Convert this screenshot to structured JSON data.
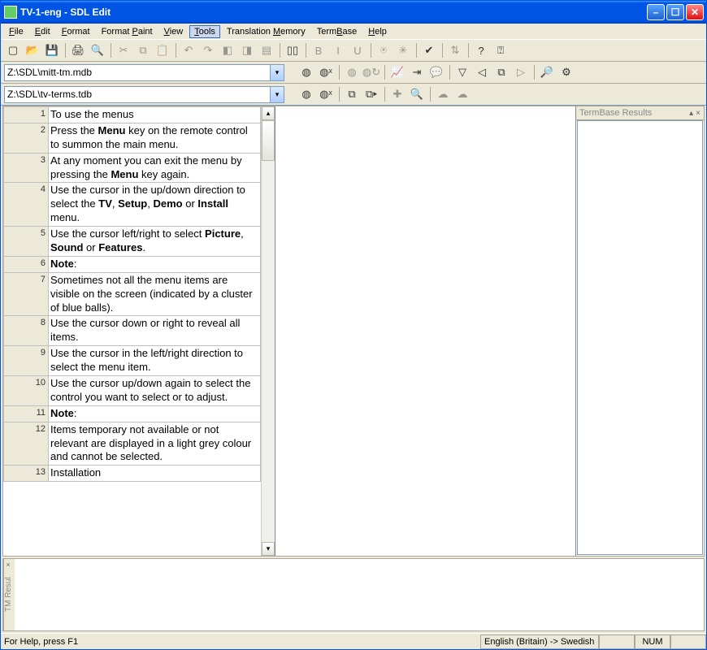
{
  "title": "TV-1-eng - SDL Edit",
  "menus": [
    "File",
    "Edit",
    "Format",
    "Format Paint",
    "View",
    "Tools",
    "Translation Memory",
    "TermBase",
    "Help"
  ],
  "menu_underline_idx": [
    0,
    0,
    0,
    7,
    0,
    0,
    12,
    4,
    0
  ],
  "menu_highlight": 5,
  "tm_path": "Z:\\SDL\\mitt-tm.mdb",
  "tb_path": "Z:\\SDL\\tv-terms.tdb",
  "termbase_panel_title": "TermBase Results",
  "tm_panel_label": "TM Resul",
  "status_help": "For Help, press F1",
  "status_lang": "English (Britain) -> Swedish",
  "status_num": "NUM",
  "segments": [
    {
      "n": 1,
      "html": "To use the menus"
    },
    {
      "n": 2,
      "html": "Press the <b>Menu</b> key on the remote control to summon the main menu."
    },
    {
      "n": 3,
      "html": "At any moment you can exit the menu by pressing the <b>Menu</b> key again."
    },
    {
      "n": 4,
      "html": "Use the cursor in the up/down direction to select the <b>TV</b>, <b>Setup</b>, <b>Demo</b> or <b>Install</b> menu."
    },
    {
      "n": 5,
      "html": "Use the cursor left/right to select <b>Picture</b>, <b>Sound</b> or <b>Features</b>."
    },
    {
      "n": 6,
      "html": "<b>Note</b>:"
    },
    {
      "n": 7,
      "html": "Sometimes not all the menu items are visible on the screen (indicated by a cluster of blue balls)."
    },
    {
      "n": 8,
      "html": "Use the cursor down or right to reveal all items."
    },
    {
      "n": 9,
      "html": "Use the cursor in the left/right direction to select the menu item."
    },
    {
      "n": 10,
      "html": "Use the cursor up/down again to select the control you want to select or to adjust."
    },
    {
      "n": 11,
      "html": "<b>Note</b>:"
    },
    {
      "n": 12,
      "html": "Items temporary not available or not relevant are displayed in a light grey colour and cannot be selected."
    },
    {
      "n": 13,
      "html": "Installation"
    }
  ],
  "toolbar1": [
    {
      "name": "new-icon",
      "g": "▢"
    },
    {
      "name": "open-icon",
      "g": "📂"
    },
    {
      "name": "save-icon",
      "g": "💾"
    },
    {
      "sep": true
    },
    {
      "name": "print-icon",
      "g": "🖨"
    },
    {
      "name": "preview-icon",
      "g": "🔍"
    },
    {
      "sep": true
    },
    {
      "name": "cut-icon",
      "g": "✂",
      "dis": true
    },
    {
      "name": "copy-icon",
      "g": "⧉",
      "dis": true
    },
    {
      "name": "paste-icon",
      "g": "📋",
      "dis": true
    },
    {
      "sep": true
    },
    {
      "name": "undo-icon",
      "g": "↶",
      "dis": true
    },
    {
      "name": "redo-icon",
      "g": "↷",
      "dis": true
    },
    {
      "name": "mark1-icon",
      "g": "◧",
      "dis": true
    },
    {
      "name": "mark2-icon",
      "g": "◨",
      "dis": true
    },
    {
      "name": "mark3-icon",
      "g": "▤",
      "dis": true
    },
    {
      "sep": true
    },
    {
      "name": "book-icon",
      "g": "▯▯"
    },
    {
      "sep": true
    },
    {
      "name": "bold-icon",
      "g": "B",
      "dis": true
    },
    {
      "name": "italic-icon",
      "g": "I",
      "dis": true
    },
    {
      "name": "underline-icon",
      "g": "U",
      "dis": true
    },
    {
      "sep": true
    },
    {
      "name": "tag1-icon",
      "g": "⍟",
      "dis": true
    },
    {
      "name": "tag2-icon",
      "g": "✳",
      "dis": true
    },
    {
      "sep": true
    },
    {
      "name": "spell-icon",
      "g": "✔"
    },
    {
      "sep": true
    },
    {
      "name": "sort-icon",
      "g": "⇅",
      "dis": true
    },
    {
      "sep": true
    },
    {
      "name": "help-icon",
      "g": "?"
    },
    {
      "name": "context-help-icon",
      "g": "⍰"
    }
  ],
  "toolbar2": [
    {
      "name": "tm-open-icon",
      "g": "◍"
    },
    {
      "name": "tm-close-icon",
      "g": "◍ˣ"
    },
    {
      "sep": true
    },
    {
      "name": "tm-lookup-icon",
      "g": "◍",
      "dis": true
    },
    {
      "name": "tm-update-icon",
      "g": "◍↻",
      "dis": true
    },
    {
      "sep": true
    },
    {
      "name": "analyse-icon",
      "g": "📈"
    },
    {
      "name": "apply-icon",
      "g": "⇥"
    },
    {
      "name": "concord-icon",
      "g": "💬",
      "dis": true
    },
    {
      "sep": true
    },
    {
      "name": "filter-icon",
      "g": "▽"
    },
    {
      "name": "prev-icon",
      "g": "◁"
    },
    {
      "name": "copy-src-icon",
      "g": "⧉"
    },
    {
      "name": "next-icon",
      "g": "▷",
      "dis": true
    },
    {
      "sep": true
    },
    {
      "name": "search-icon",
      "g": "🔎"
    },
    {
      "name": "settings-icon",
      "g": "⚙"
    }
  ],
  "toolbar3": [
    {
      "name": "tb-open-icon",
      "g": "◍"
    },
    {
      "name": "tb-close-icon",
      "g": "◍ˣ"
    },
    {
      "sep": true
    },
    {
      "name": "tb-copy-icon",
      "g": "⧉"
    },
    {
      "name": "tb-paste-icon",
      "g": "⧉▸"
    },
    {
      "sep": true
    },
    {
      "name": "tb-add-icon",
      "g": "✚",
      "dis": true
    },
    {
      "name": "tb-search-icon",
      "g": "🔍"
    },
    {
      "sep": true
    },
    {
      "name": "tb-cloud1-icon",
      "g": "☁",
      "dis": true
    },
    {
      "name": "tb-cloud2-icon",
      "g": "☁",
      "dis": true
    }
  ]
}
